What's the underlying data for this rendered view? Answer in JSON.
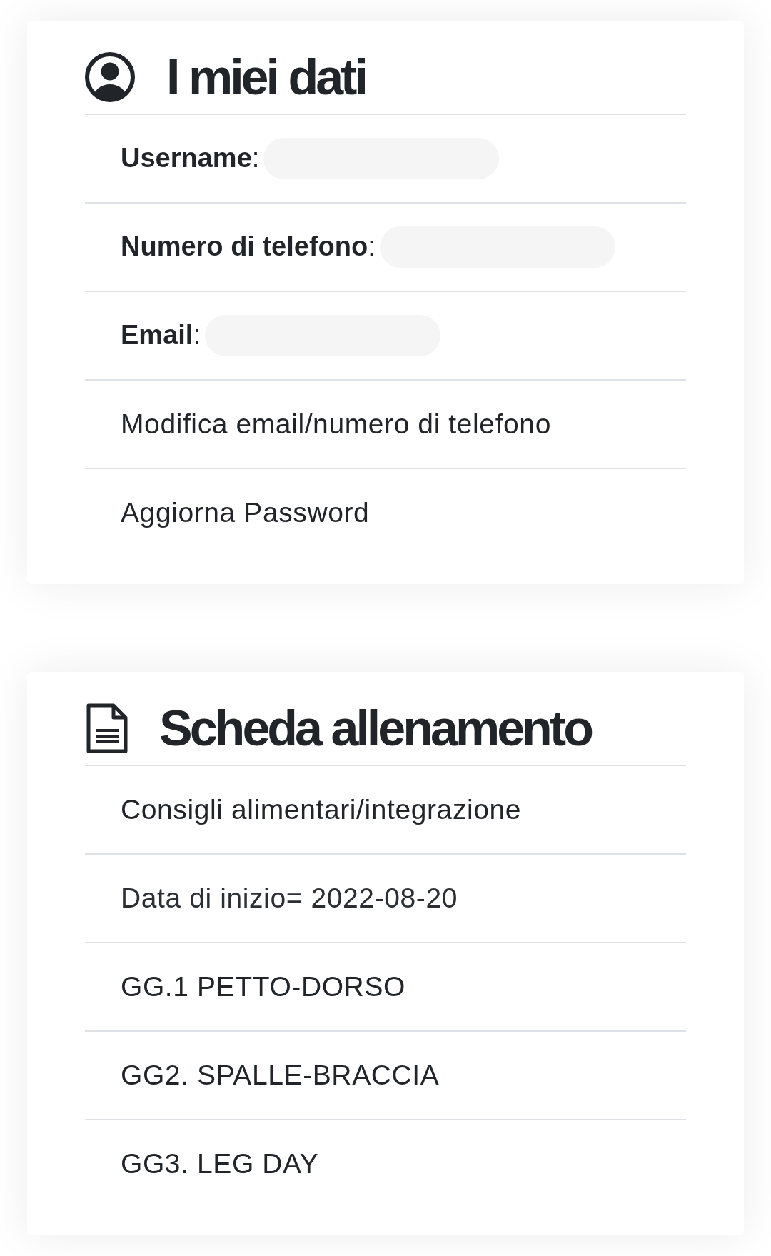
{
  "sections": [
    {
      "kind": "account",
      "title": "I miei dati",
      "items": [
        {
          "kind": "field",
          "label": "**Username**:",
          "redacted": true
        },
        {
          "kind": "field",
          "label": "**Numero di telefono**:",
          "redacted": true
        },
        {
          "kind": "field",
          "label": "**Email**:",
          "redacted": true
        },
        {
          "kind": "link",
          "label": "Modifica email/numero di telefono"
        },
        {
          "kind": "link",
          "label": "Aggiorna Password"
        }
      ]
    },
    {
      "kind": "plan",
      "title": "Scheda allenamento",
      "items": [
        {
          "kind": "link",
          "label": "Consigli alimentari/integrazione"
        },
        {
          "kind": "text",
          "label": "Data di inizio= 2022-08-20"
        },
        {
          "kind": "link",
          "label": "GG.1 PETTO-DORSO"
        },
        {
          "kind": "link",
          "label": "GG2. SPALLE-BRACCIA"
        },
        {
          "kind": "link",
          "label": "GG3. LEG DAY"
        }
      ]
    }
  ]
}
